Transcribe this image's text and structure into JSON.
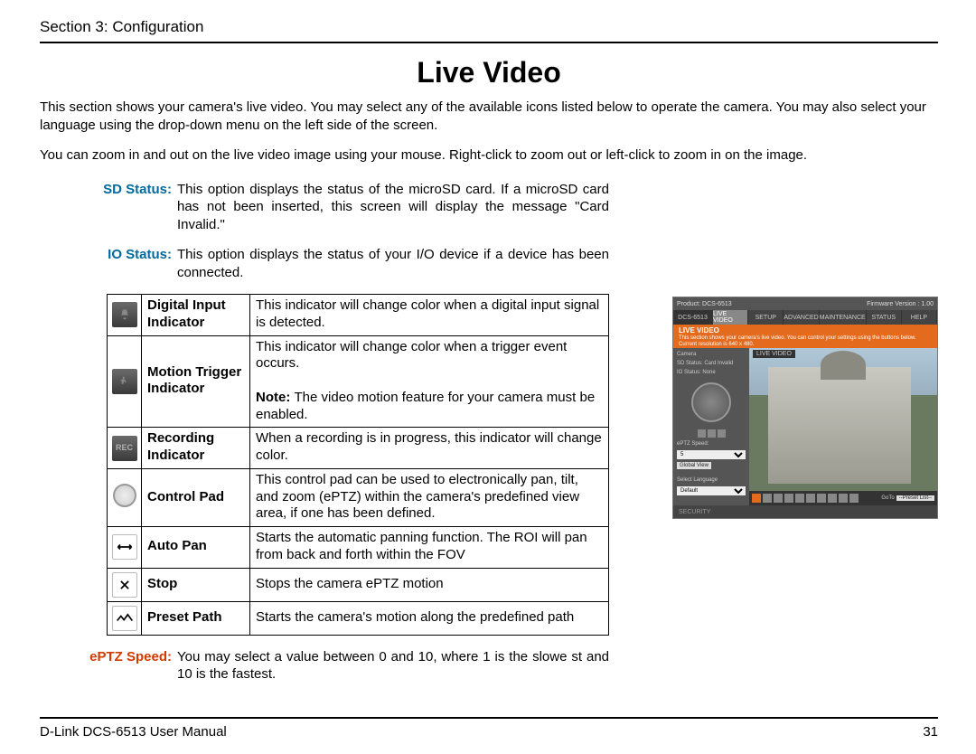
{
  "header": {
    "section": "Section 3: Configuration"
  },
  "title": "Live Video",
  "intro1": "This section shows your camera's live video. You may select any of the available icons listed below to operate the camera. You may also select your language using the drop-down menu on the left side of the screen.",
  "intro2": "You can zoom in and out on the live video image using your mouse. Right-click to zoom out or left-click to zoom in on the image.",
  "defs": [
    {
      "label": "SD Status:",
      "text": "This option displays the status of the microSD card. If a microSD card has not been inserted, this screen will display the message \"Card Invalid.\""
    },
    {
      "label": "IO Status:",
      "text": "This option displays the status of your I/O device if a device has been connected."
    }
  ],
  "table": [
    {
      "icon": "bell-icon",
      "name": "Digital Input Indicator",
      "desc": "This indicator will change color when a digital input signal is detected."
    },
    {
      "icon": "motion-icon",
      "name": "Motion Trigger Indicator",
      "desc": "This indicator will change color when a trigger event occurs.",
      "note": "The video motion feature for your camera must be enabled."
    },
    {
      "icon": "rec-icon",
      "name": "Recording Indicator",
      "desc": "When a recording is in progress, this indicator will change color."
    },
    {
      "icon": "control-pad-icon",
      "name": "Control Pad",
      "desc": "This control pad can be used to electronically pan, tilt, and zoom (ePTZ) within the camera's predefined view area, if one has been defined."
    },
    {
      "icon": "autopan-icon",
      "name": "Auto Pan",
      "desc": "Starts the automatic panning function. The ROI will pan from back and forth within the FOV"
    },
    {
      "icon": "stop-icon",
      "name": "Stop",
      "desc": "Stops the camera ePTZ motion"
    },
    {
      "icon": "preset-icon",
      "name": "Preset Path",
      "desc": "Starts the camera's motion along the predefined path"
    }
  ],
  "eptz": {
    "label": "ePTZ Speed:",
    "text": "You may select a value between 0 and 10, where 1 is the slowe st and 10 is the fastest."
  },
  "footer": {
    "left": "D-Link DCS-6513 User Manual",
    "page": "31"
  },
  "shot": {
    "product": "Product: DCS-6513",
    "fw": "Firmware Version : 1.00",
    "model": "DCS-6513",
    "tabs": [
      "LIVE VIDEO",
      "SETUP",
      "ADVANCED",
      "MAINTENANCE",
      "STATUS",
      "HELP"
    ],
    "banner_title": "LIVE VIDEO",
    "banner_text": "This section shows your camera's live video. You can control your settings using the buttons below. Current resolution is 640 x 480.",
    "side": {
      "camera": "Camera",
      "sd": "SD Status:  Card Invalid",
      "io": "IO Status:  None",
      "eptz": "ePTZ Speed:",
      "global": "Global View",
      "lang": "Select Language",
      "default": "Default"
    },
    "bottom": {
      "goto": "GoTo",
      "preset": "--Preset List--"
    },
    "security": "SECURITY"
  }
}
